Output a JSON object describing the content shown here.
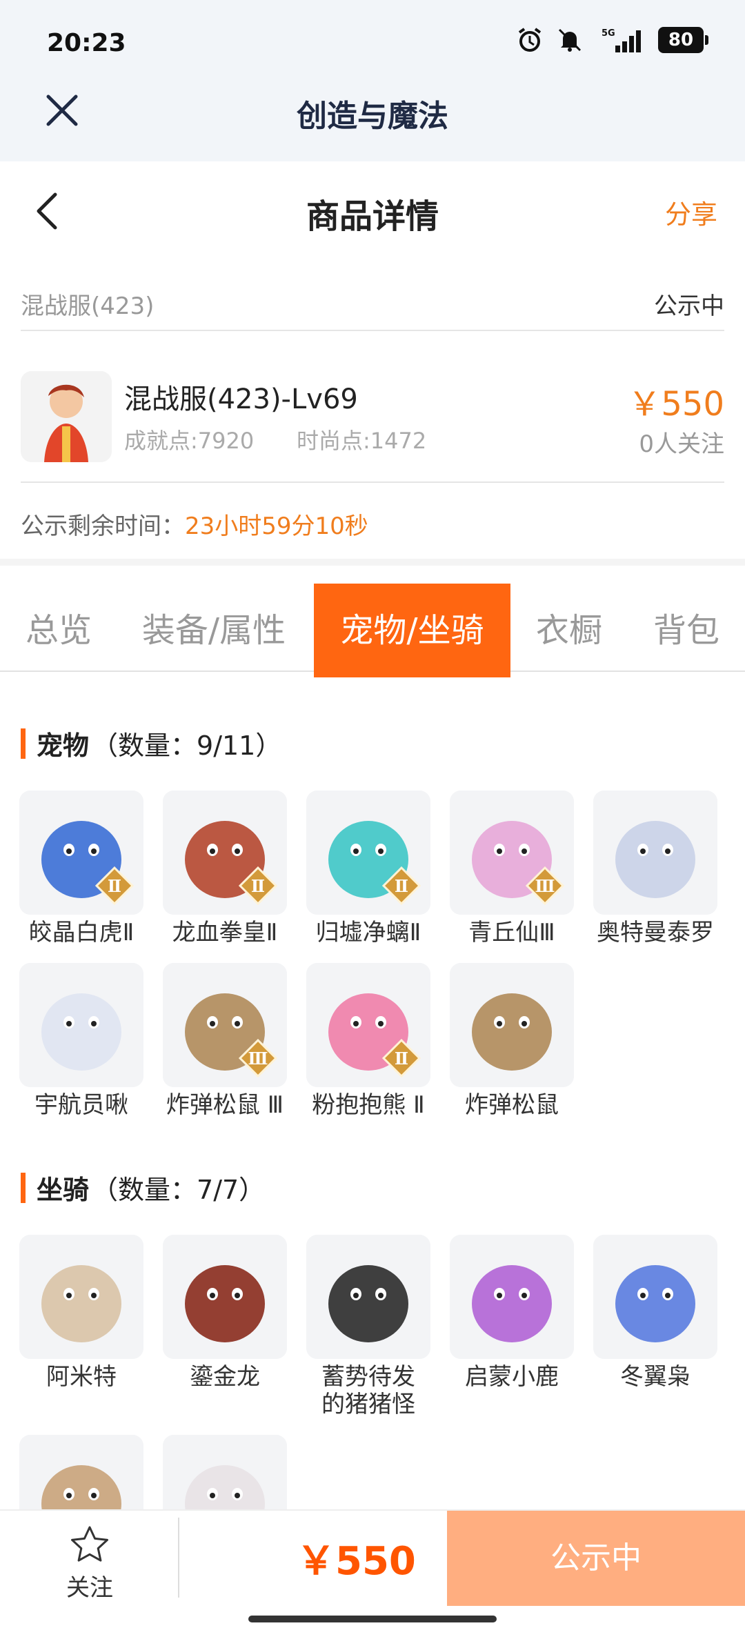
{
  "status_bar": {
    "time": "20:23",
    "network": "5G",
    "battery": "80"
  },
  "app_bar": {
    "title": "创造与魔法"
  },
  "page_header": {
    "title": "商品详情",
    "share": "分享"
  },
  "server": {
    "name": "混战服(423)",
    "status": "公示中"
  },
  "product": {
    "name": "混战服(423)-Lv69",
    "achievement": "成就点:7920",
    "fashion": "时尚点:1472",
    "price": "￥550",
    "followers": "0人关注"
  },
  "remaining": {
    "label": "公示剩余时间：",
    "value": "23小时59分10秒"
  },
  "tabs": [
    {
      "label": "总览",
      "active": false
    },
    {
      "label": "装备/属性",
      "active": false
    },
    {
      "label": "宠物/坐骑",
      "active": true
    },
    {
      "label": "衣橱",
      "active": false
    },
    {
      "label": "背包",
      "active": false
    }
  ],
  "pets": {
    "title": "宠物",
    "count": "（数量：9/11）",
    "items": [
      {
        "label": "皎晶白虎Ⅱ",
        "icon": "white-tiger-pet-image",
        "color": "#3b6fd6",
        "badge": "Ⅱ"
      },
      {
        "label": "龙血拳皇Ⅱ",
        "icon": "dragon-blood-pet-image",
        "color": "#b5472f",
        "badge": "Ⅱ"
      },
      {
        "label": "归墟净螭Ⅱ",
        "icon": "water-dragon-pet-image",
        "color": "#3ec7c7",
        "badge": "Ⅱ"
      },
      {
        "label": "青丘仙Ⅲ",
        "icon": "fox-fairy-pet-image",
        "color": "#e7a7d8",
        "badge": "Ⅲ"
      },
      {
        "label": "奥特曼泰罗",
        "icon": "ultraman-pet-image",
        "color": "#c9d2e8",
        "badge": ""
      },
      {
        "label": "宇航员啾",
        "icon": "astronaut-pet-image",
        "color": "#dfe4f2",
        "badge": ""
      },
      {
        "label": "炸弹松鼠 Ⅲ",
        "icon": "bomb-squirrel-pet-image",
        "color": "#b08b5a",
        "badge": "Ⅲ"
      },
      {
        "label": "粉抱抱熊 Ⅱ",
        "icon": "pink-bear-pet-image",
        "color": "#ef7ea8",
        "badge": "Ⅱ"
      },
      {
        "label": "炸弹松鼠",
        "icon": "bomb-squirrel-pet-image",
        "color": "#b08b5a",
        "badge": ""
      }
    ]
  },
  "mounts": {
    "title": "坐骑",
    "count": "（数量：7/7）",
    "items": [
      {
        "label": "阿米特",
        "icon": "crocodile-mount-image",
        "color": "#d9c3a6"
      },
      {
        "label": "鎏金龙",
        "icon": "gold-dragon-mount-image",
        "color": "#8a2b1d"
      },
      {
        "label": "蓄势待发的猪猪怪",
        "icon": "pig-monster-mount-image",
        "color": "#2b2b2b"
      },
      {
        "label": "启蒙小鹿",
        "icon": "deer-mount-image",
        "color": "#b164d6"
      },
      {
        "label": "冬翼枭",
        "icon": "owl-mount-image",
        "color": "#5a7ce0"
      },
      {
        "label": "",
        "icon": "eagle-mount-image",
        "color": "#c9a37a"
      },
      {
        "label": "",
        "icon": "white-dragon-mount-image",
        "color": "#e8e2e6"
      }
    ]
  },
  "bottom_bar": {
    "follow_label": "关注",
    "price": "￥550",
    "action": "公示中"
  }
}
